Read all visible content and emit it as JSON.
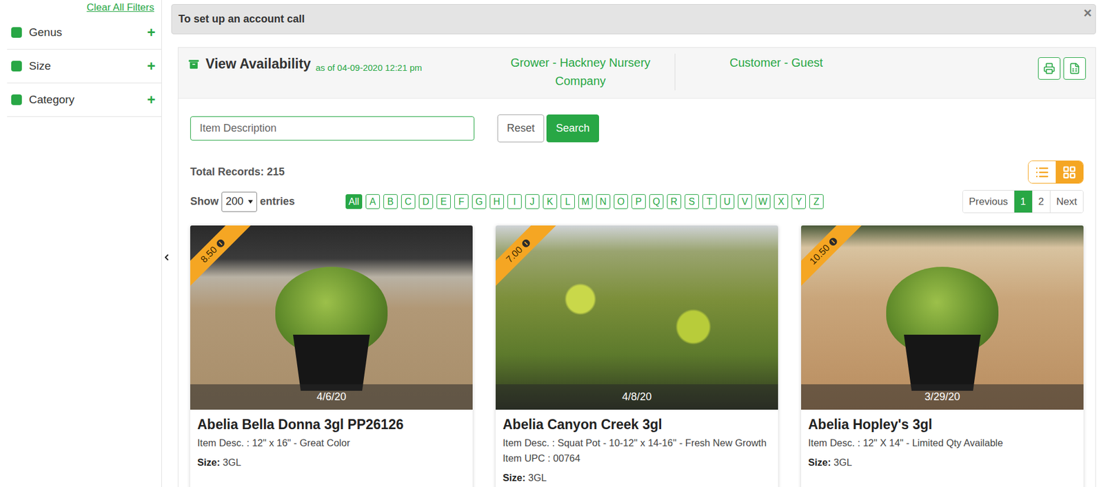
{
  "sidebar": {
    "clear_link": "Clear All Filters",
    "filters": [
      {
        "label": "Genus",
        "icon": "+",
        "expanded": false
      },
      {
        "label": "Size",
        "icon": "+",
        "expanded": false
      },
      {
        "label": "Category",
        "icon": "+",
        "expanded": false
      }
    ]
  },
  "alert": {
    "text": "To set up an account call",
    "close": "×"
  },
  "panel": {
    "title": "View Availability",
    "as_of": "as of 04-09-2020 12:21 pm",
    "grower": "Grower - Hackney Nursery Company",
    "customer": "Customer - Guest"
  },
  "search": {
    "placeholder": "Item Description",
    "reset": "Reset",
    "submit": "Search"
  },
  "total": {
    "label": "Total Records:",
    "value": "215"
  },
  "view_modes": [
    {
      "mode": "list",
      "selected": false
    },
    {
      "mode": "grid",
      "selected": true
    }
  ],
  "entries": {
    "prefix": "Show",
    "value": "200",
    "suffix": "entries"
  },
  "letters": [
    {
      "label": "All",
      "selected": true
    },
    {
      "label": "A",
      "selected": false
    },
    {
      "label": "B",
      "selected": false
    },
    {
      "label": "C",
      "selected": false
    },
    {
      "label": "D",
      "selected": false
    },
    {
      "label": "E",
      "selected": false
    },
    {
      "label": "F",
      "selected": false
    },
    {
      "label": "G",
      "selected": false
    },
    {
      "label": "H",
      "selected": false
    },
    {
      "label": "I",
      "selected": false
    },
    {
      "label": "J",
      "selected": false
    },
    {
      "label": "K",
      "selected": false
    },
    {
      "label": "L",
      "selected": false
    },
    {
      "label": "M",
      "selected": false
    },
    {
      "label": "N",
      "selected": false
    },
    {
      "label": "O",
      "selected": false
    },
    {
      "label": "P",
      "selected": false
    },
    {
      "label": "Q",
      "selected": false
    },
    {
      "label": "R",
      "selected": false
    },
    {
      "label": "S",
      "selected": false
    },
    {
      "label": "T",
      "selected": false
    },
    {
      "label": "U",
      "selected": false
    },
    {
      "label": "V",
      "selected": false
    },
    {
      "label": "W",
      "selected": false
    },
    {
      "label": "X",
      "selected": false
    },
    {
      "label": "Y",
      "selected": false
    },
    {
      "label": "Z",
      "selected": false
    }
  ],
  "pagination": {
    "previous": "Previous",
    "pages": [
      {
        "label": "1",
        "selected": true
      },
      {
        "label": "2",
        "selected": false
      }
    ],
    "next": "Next"
  },
  "cards": [
    {
      "price": "8.50",
      "date": "4/6/20",
      "title": "Abelia Bella Donna 3gl PP26126",
      "details": [
        {
          "label": "Item Desc. :",
          "value": "12\" x 16\" - Great Color"
        }
      ],
      "size_label": "Size:",
      "size": "3GL"
    },
    {
      "price": "7.00",
      "date": "4/8/20",
      "title": "Abelia Canyon Creek 3gl",
      "details": [
        {
          "label": "Item Desc. :",
          "value": "Squat Pot - 10-12'' x 14-16'' - Fresh New Growth"
        },
        {
          "label": "Item UPC :",
          "value": "00764"
        }
      ],
      "size_label": "Size:",
      "size": "3GL"
    },
    {
      "price": "10.50",
      "date": "3/29/20",
      "title": "Abelia Hopley's 3gl",
      "details": [
        {
          "label": "Item Desc. :",
          "value": "12\" X 14\" - Limited Qty Available"
        }
      ],
      "size_label": "Size:",
      "size": "3GL"
    }
  ]
}
